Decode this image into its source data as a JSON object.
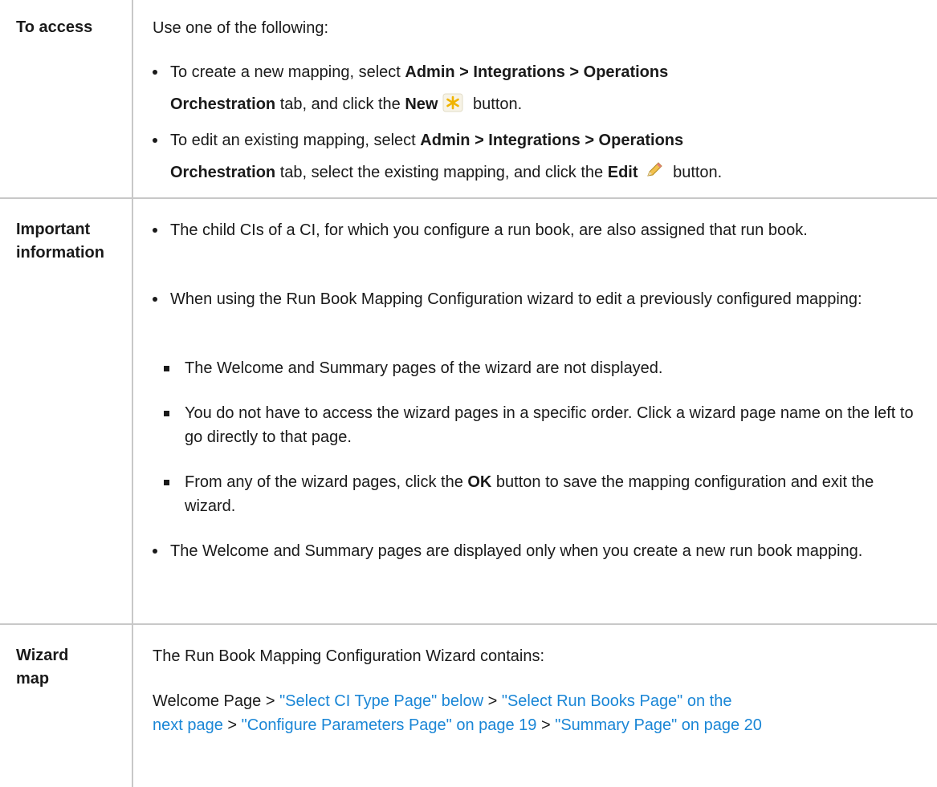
{
  "rows": {
    "access": {
      "label": "To access",
      "intro": "Use one of the following:",
      "b1": {
        "t1": "To create a new mapping, select ",
        "bold1": "Admin > Integrations > Operations",
        "bold2": "Orchestration",
        "t2": " tab, and click the ",
        "bold3": "New",
        "t3": " button.",
        "icon": "new-star-icon"
      },
      "b2": {
        "t1": "To edit an existing mapping, select ",
        "bold1": "Admin > Integrations > Operations",
        "bold2": "Orchestration",
        "t2": " tab, select the existing mapping, and click the ",
        "bold3": "Edit",
        "t3": " button.",
        "icon": "pencil-icon"
      }
    },
    "important": {
      "label_line1": "Important",
      "label_line2": "information",
      "b1": "The child CIs of a CI, for which you configure a run book, are also assigned that run book.",
      "b2": "When using the Run Book Mapping Configuration wizard to edit a previously configured mapping:",
      "s1": "The Welcome and Summary pages of the wizard are not displayed.",
      "s2": "You do not have to access the wizard pages in a specific order. Click a wizard page name on the left to go directly to that page.",
      "s3": {
        "t1": "From any of the wizard pages, click the ",
        "bold": "OK",
        "t2": " button to save the mapping configuration and exit the wizard."
      },
      "b3": "The Welcome and Summary pages are displayed only when you create a new run book mapping."
    },
    "wizard": {
      "label_line1": "Wizard",
      "label_line2": "map",
      "intro": "The Run Book Mapping Configuration Wizard contains:",
      "seq": {
        "start": "Welcome Page",
        "sep": " > ",
        "link1": "\"Select CI Type Page\" below",
        "link2a": "\"Select Run Books Page\" on the",
        "link2b": "next page",
        "link3": "\"Configure Parameters Page\" on page 19",
        "link4": "\"Summary Page\" on page 20"
      }
    }
  },
  "colors": {
    "link": "#1a86d6",
    "border": "#c8c8c8",
    "text": "#1a1a1a"
  }
}
